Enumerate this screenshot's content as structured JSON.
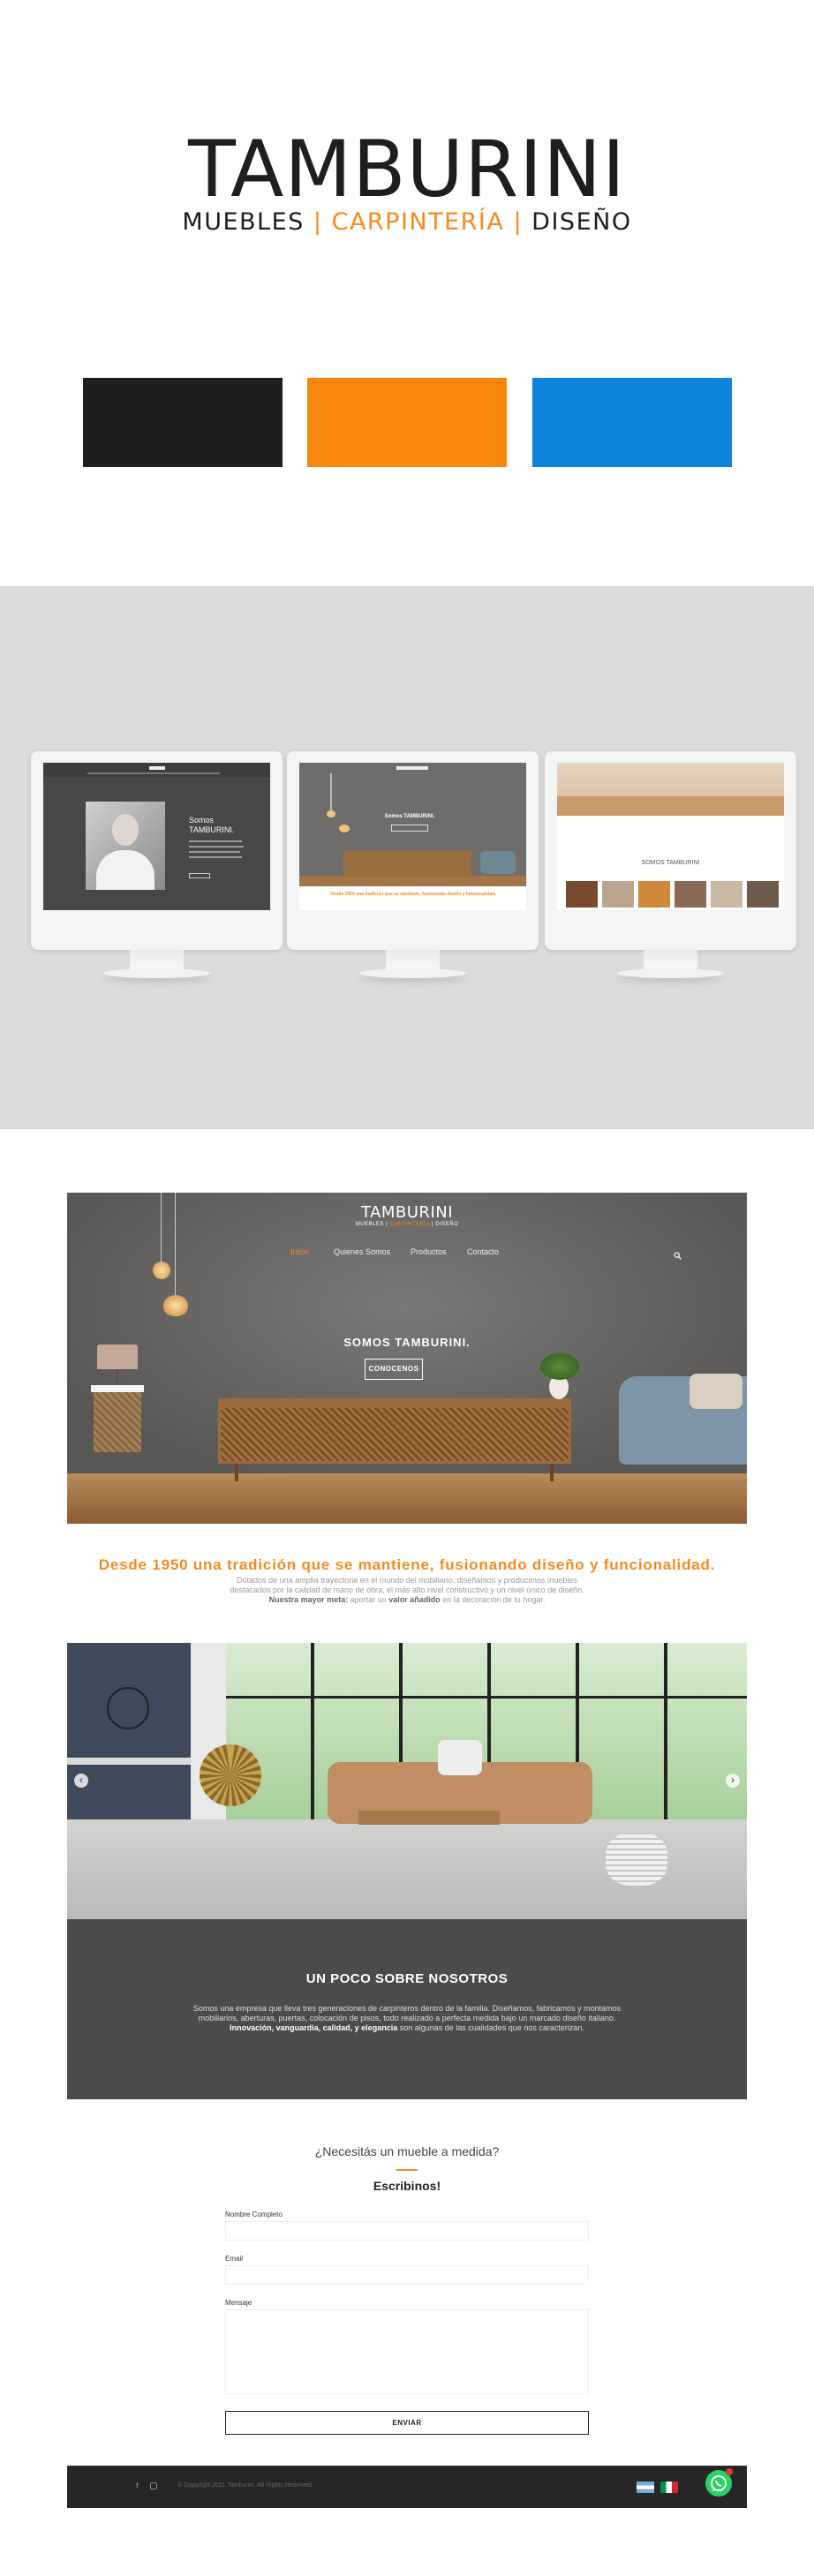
{
  "brand": {
    "name": "TAMBURINI",
    "sub_1": "MUEBLES",
    "sep_1": "|",
    "sub_2": "CARPINTERÍA",
    "sep_2": "|",
    "sub_3": "DISEÑO"
  },
  "palette": [
    "#1e1e1e",
    "#f7860d",
    "#0d83dc"
  ],
  "mockups": {
    "screen_1_heading": "Somos TAMBURINI.",
    "screen_2_heading": "Somos TAMBURINI.",
    "screen_2_tagline": "Desde 1950 una tradición que se mantiene, fusionando diseño y funcionalidad.",
    "screen_3_heading": "SOMOS TAMBURINI"
  },
  "site": {
    "logo": "TAMBURINI",
    "logo_sub_1": "MUEBLES",
    "logo_sub_2": "CARPINTERÍA",
    "logo_sub_3": "DISEÑO",
    "nav": [
      {
        "label": "Inicio",
        "active": true
      },
      {
        "label": "Quienes Somos",
        "active": false
      },
      {
        "label": "Productos",
        "active": false
      },
      {
        "label": "Contacto",
        "active": false
      }
    ],
    "hero_heading": "SOMOS TAMBURINI.",
    "hero_button": "CONOCENOS",
    "tagline": "Desde 1950 una tradición que se mantiene, fusionando diseño y funcionalidad.",
    "intro_1": "Dotados de una amplia trayectoria en el mundo del mobiliario, diseñamos y producimos muebles destacados por la calidad de mano de obra, el más alto nivel constructivo y un nivel único de diseño.",
    "intro_2_bold": "Nuestra mayor meta:",
    "intro_3": " aportar un ",
    "intro_4_bold": "valor añadido",
    "intro_5": " en la decoración de tu hogar.",
    "slider_prev": "‹",
    "slider_next": "›",
    "about_title": "UN POCO SOBRE NOSOTROS",
    "about_1": "Somos una empresa que lleva tres generaciones de carpinteros dentro de la familia. Diseñamos, fabricamos y montamos mobiliarios, aberturas, puertas, colocación de pisos, todo realizado a perfecta medida bajo un marcado diseño italiano. ",
    "about_2_bold": "Innovación, vanguardia, calidad, y elegancia",
    "about_3": " son algunas de las cualidades que nos caracterizan.",
    "contact_question": "¿Necesitás un mueble a medida?",
    "contact_heading": "Escribinos!",
    "form": {
      "name_label": "Nombre Completo",
      "email_label": "Email",
      "message_label": "Mensaje",
      "submit": "ENVIAR"
    },
    "footer_copy": "© Copyright 2021 Tamburini. All Rights Reserved"
  }
}
